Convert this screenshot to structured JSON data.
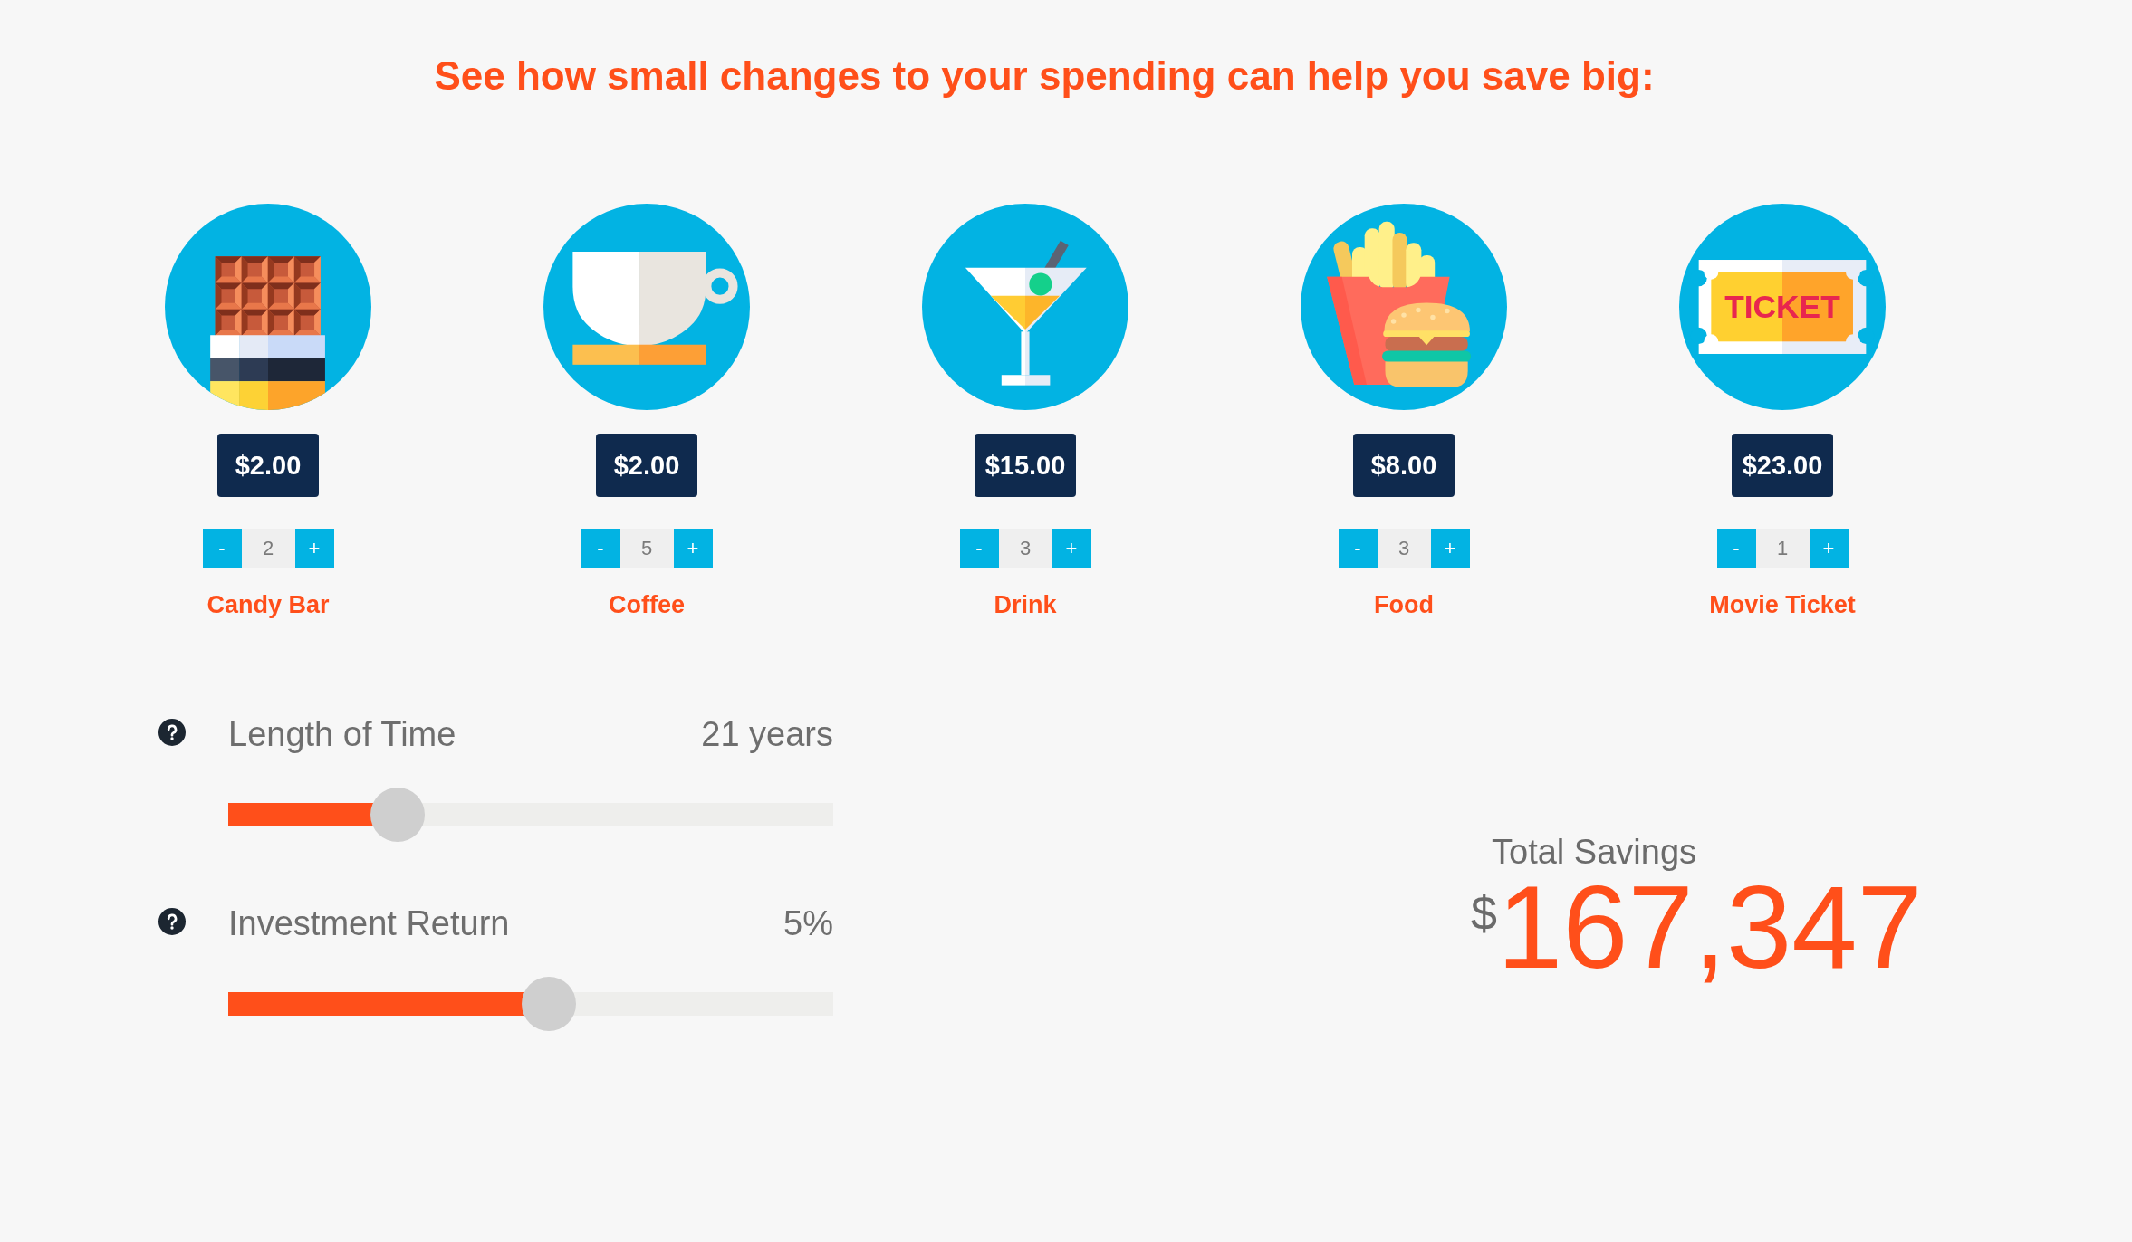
{
  "heading": "See how small changes to your spending can help you save big:",
  "items": [
    {
      "kind": "candy_bar",
      "price": "$2.00",
      "decrease": "-",
      "quantity": "2",
      "increase": "+",
      "name": "Candy Bar"
    },
    {
      "kind": "coffee",
      "price": "$2.00",
      "decrease": "-",
      "quantity": "5",
      "increase": "+",
      "name": "Coffee"
    },
    {
      "kind": "drink",
      "price": "$15.00",
      "decrease": "-",
      "quantity": "3",
      "increase": "+",
      "name": "Drink"
    },
    {
      "kind": "food",
      "price": "$8.00",
      "decrease": "-",
      "quantity": "3",
      "increase": "+",
      "name": "Food"
    },
    {
      "kind": "ticket",
      "icon_text": "TICKET",
      "price": "$23.00",
      "decrease": "-",
      "quantity": "1",
      "increase": "+",
      "name": "Movie Ticket"
    }
  ],
  "sliders": [
    {
      "label": "Length of Time",
      "reading": "21 years",
      "level": 0.28
    },
    {
      "label": "Investment Return",
      "reading": "5%",
      "level": 0.53
    }
  ],
  "total": {
    "label": "Total Savings",
    "currency": "$",
    "amount": "167,347"
  }
}
